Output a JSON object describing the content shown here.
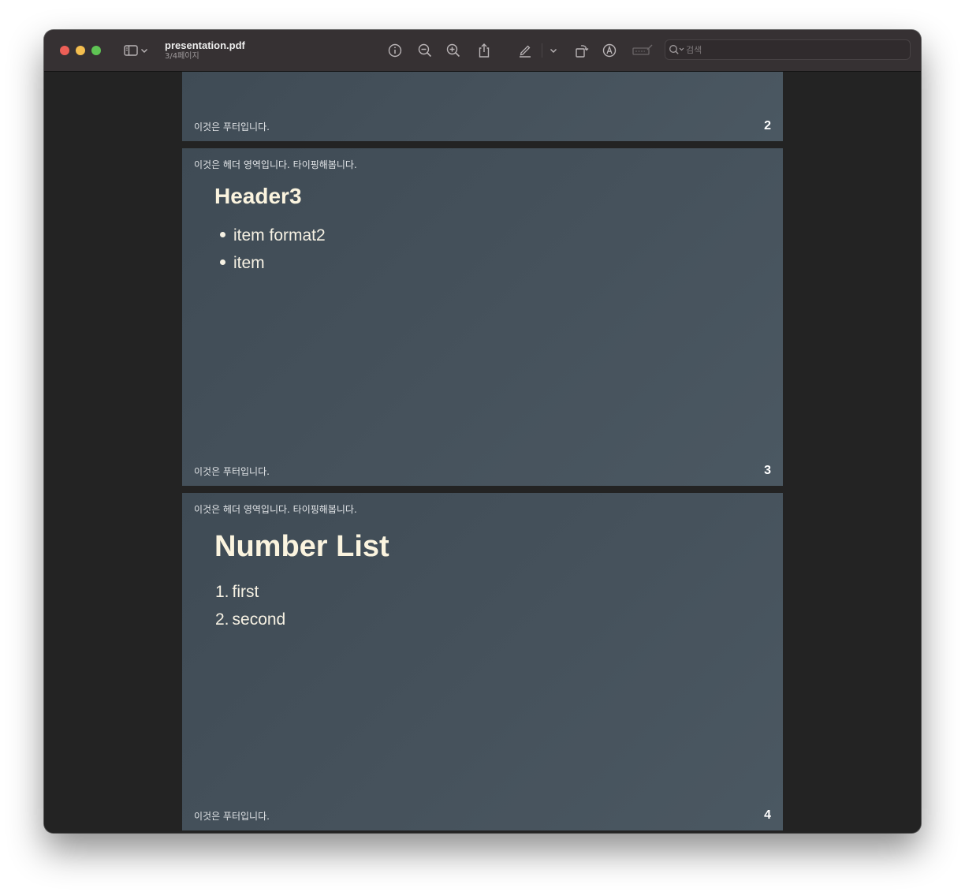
{
  "window": {
    "title": "presentation.pdf",
    "subtitle": "3/4페이지"
  },
  "toolbar": {
    "icons": [
      "sidebar-icon",
      "chevron-down-icon",
      "info-icon",
      "zoom-out-icon",
      "zoom-in-icon",
      "share-icon",
      "highlight-pen-icon",
      "chevron-down-icon",
      "rotate-icon",
      "markup-icon",
      "form-fill-icon"
    ]
  },
  "search": {
    "placeholder": "검색",
    "value": ""
  },
  "pages": [
    {
      "footer": "이것은 푸터입니다.",
      "number": "2"
    },
    {
      "header": "이것은 헤더 영역입니다. 타이핑해봅니다.",
      "title": "Header3",
      "items": [
        "item format2",
        "item"
      ],
      "footer": "이것은 푸터입니다.",
      "number": "3"
    },
    {
      "header": "이것은 헤더 영역입니다. 타이핑해봅니다.",
      "title": "Number List",
      "items": [
        "first",
        "second"
      ],
      "markers": [
        "1.",
        "2."
      ],
      "footer": "이것은 푸터입니다.",
      "number": "4"
    }
  ],
  "colors": {
    "window_background": "#232323",
    "titlebar": "#363133",
    "slide_background": "#44505a",
    "slide_title": "#fbf4df",
    "close": "#ed5f57",
    "minimize": "#f4be4f",
    "maximize": "#5fc454"
  }
}
